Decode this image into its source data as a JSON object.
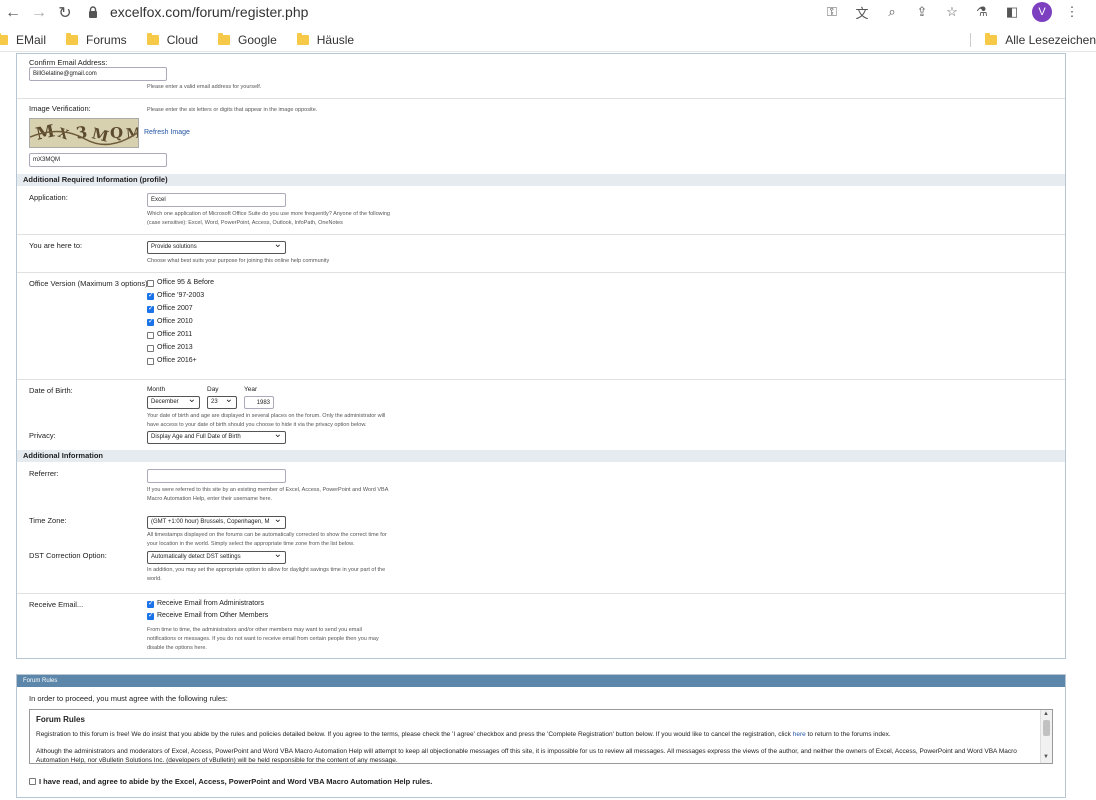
{
  "browser": {
    "url": "excelfox.com/forum/register.php",
    "avatar_letter": "V"
  },
  "bookmarks": {
    "items": [
      "EMail",
      "Forums",
      "Cloud",
      "Google",
      "Häusle"
    ],
    "right": "Alle Lesezeichen"
  },
  "form": {
    "confirm_email": {
      "label": "Confirm Email Address:",
      "value": "BillGelatine@gmail.com",
      "hint": "Please enter a valid email address for yourself."
    },
    "image_verification": {
      "label": "Image Verification:",
      "hint": "Please enter the six letters or digits that appear in the image opposite.",
      "captcha_text": "MX3MQM",
      "refresh": "Refresh Image",
      "value": "mX3MQM"
    },
    "section_profile": "Additional Required Information (profile)",
    "application": {
      "label": "Application:",
      "value": "Excel",
      "hint1": "Which one application of Microsoft Office Suite do you use more frequently? Anyone of the following",
      "hint2": "(case sensitive): Excel, Word, PowerPoint, Access, Outlook, InfoPath, OneNotes"
    },
    "here_to": {
      "label": "You are here to:",
      "value": "Provide solutions",
      "hint": "Choose what best suits your purpose for joining this online help community"
    },
    "office_version": {
      "label": "Office Version (Maximum 3 options):",
      "options": [
        {
          "label": "Office 95 & Before",
          "checked": false
        },
        {
          "label": "Office '97-2003",
          "checked": true
        },
        {
          "label": "Office 2007",
          "checked": true
        },
        {
          "label": "Office 2010",
          "checked": true
        },
        {
          "label": "Office 2011",
          "checked": false
        },
        {
          "label": "Office 2013",
          "checked": false
        },
        {
          "label": "Office 2016+",
          "checked": false
        }
      ]
    },
    "dob": {
      "label": "Date of Birth:",
      "month_label": "Month",
      "day_label": "Day",
      "year_label": "Year",
      "month": "December",
      "day": "23",
      "year": "1983",
      "hint1": "Your date of birth and age are displayed in several places on the forum. Only the administrator will",
      "hint2": "have access to your date of birth should you choose to hide it via the privacy option below."
    },
    "privacy": {
      "label": "Privacy:",
      "value": "Display Age and Full Date of Birth"
    },
    "section_additional": "Additional Information",
    "referrer": {
      "label": "Referrer:",
      "hint1": "If you were referred to this site by an existing member of Excel, Access, PowerPoint and Word VBA",
      "hint2": "Macro Automation Help, enter their username here."
    },
    "timezone": {
      "label": "Time Zone:",
      "value": "(GMT +1:00 hour) Brussels, Copenhagen, M",
      "hint1": "All timestamps displayed on the forums can be automatically corrected to show the correct time for",
      "hint2": "your location in the world. Simply select the appropriate time zone from the list below."
    },
    "dst": {
      "label": "DST Correction Option:",
      "value": "Automatically detect DST settings",
      "hint1": "In addition, you may set the appropriate option to allow for daylight savings time in your part of the",
      "hint2": "world."
    },
    "receive_email": {
      "label": "Receive Email...",
      "options": [
        {
          "label": "Receive Email from Administrators",
          "checked": true
        },
        {
          "label": "Receive Email from Other Members",
          "checked": true
        }
      ],
      "hint1": "From time to time, the administrators and/or other members may want to send you email",
      "hint2": "notifications or messages. If you do not want to receive email from certain people then you may",
      "hint3": "disable the options here."
    }
  },
  "rules": {
    "header": "Forum Rules",
    "intro": "In order to proceed, you must agree with the following rules:",
    "title": "Forum Rules",
    "p1_a": "Registration to this forum is free! We do insist that you abide by the rules and policies detailed below. If you agree to the terms, please check the 'I agree' checkbox and press the 'Complete Registration' button below. If you would like to cancel the registration, click ",
    "p1_link": "here",
    "p1_b": " to return to the forums index.",
    "p2": "Although the administrators and moderators of Excel, Access, PowerPoint and Word VBA Macro Automation Help will attempt to keep all objectionable messages off this site, it is impossible for us to review all messages. All messages express the views of the author, and neither the owners of Excel, Access, PowerPoint and Word VBA Macro Automation Help, nor vBulletin Solutions Inc. (developers of vBulletin) will be held responsible for the content of any message.",
    "agree": "I have read, and agree to abide by the Excel, Access, PowerPoint and Word VBA Macro Automation Help rules."
  }
}
